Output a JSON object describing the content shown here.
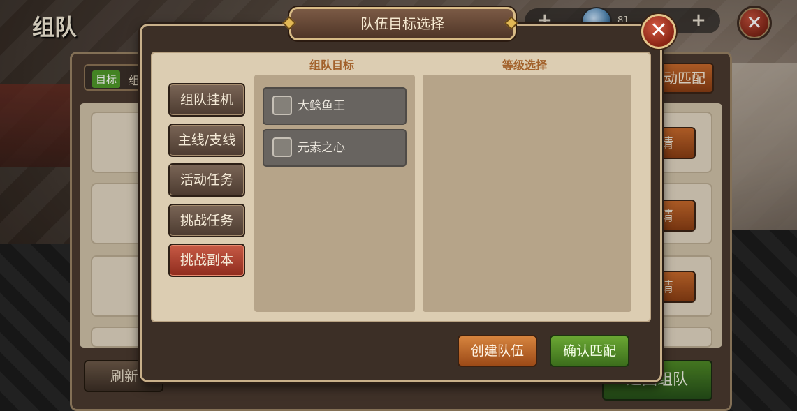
{
  "background": {
    "page_title": "组队",
    "target_tag": "目标",
    "target_text": "组",
    "auto_match_label": "动匹配",
    "invite_label": "请",
    "refresh_label": "刷新",
    "return_label": "返回组队",
    "gem_count": "81"
  },
  "modal": {
    "title": "队伍目标选择",
    "goal_header": "组队目标",
    "level_header": "等级选择",
    "categories": [
      {
        "label": "组队挂机",
        "active": false
      },
      {
        "label": "主线/支线",
        "active": false
      },
      {
        "label": "活动任务",
        "active": false
      },
      {
        "label": "挑战任务",
        "active": false
      },
      {
        "label": "挑战副本",
        "active": true
      }
    ],
    "targets": [
      {
        "label": "大鲶鱼王",
        "checked": false
      },
      {
        "label": "元素之心",
        "checked": false
      }
    ],
    "create_team_label": "创建队伍",
    "confirm_match_label": "确认匹配"
  },
  "icons": {
    "close": "close-icon",
    "plus": "plus-icon",
    "gem": "gem-icon",
    "checkbox": "checkbox-icon"
  }
}
